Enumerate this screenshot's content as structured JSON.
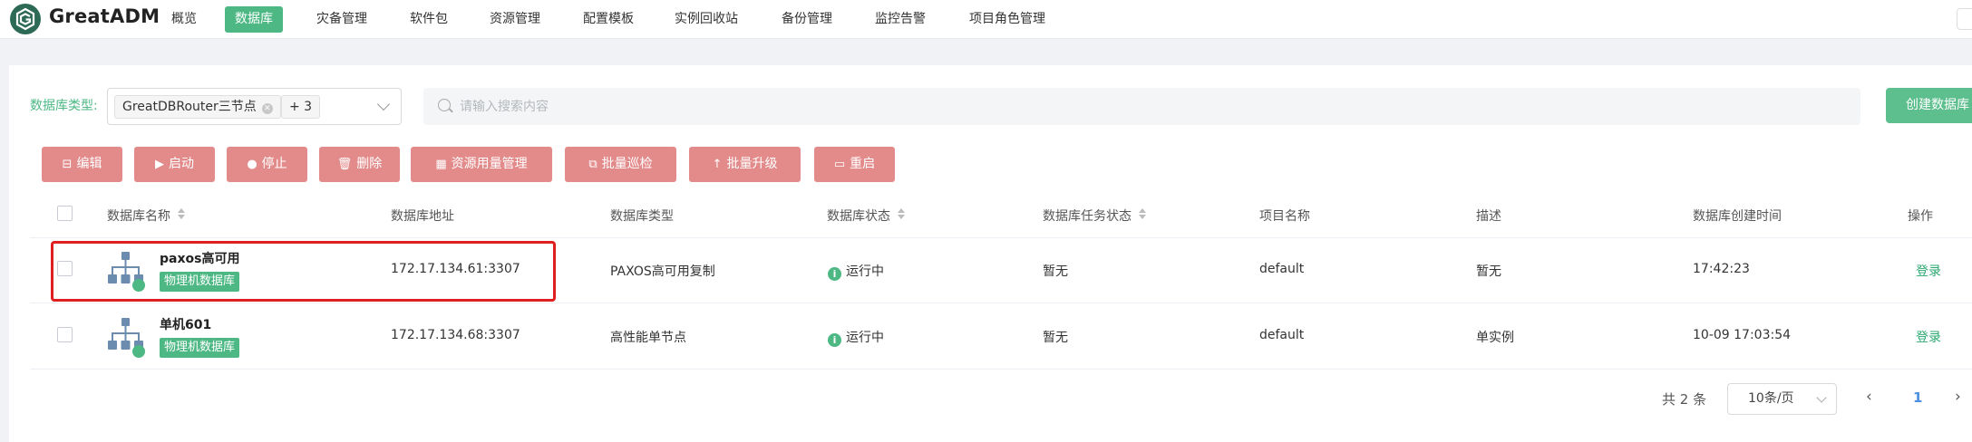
{
  "brand": "GreatADM",
  "nav": [
    {
      "label": "概览"
    },
    {
      "label": "数据库",
      "active": true
    },
    {
      "label": "灾备管理"
    },
    {
      "label": "软件包"
    },
    {
      "label": "资源管理"
    },
    {
      "label": "配置模板"
    },
    {
      "label": "实例回收站"
    },
    {
      "label": "备份管理"
    },
    {
      "label": "监控告警"
    },
    {
      "label": "项目角色管理"
    }
  ],
  "filter": {
    "label": "数据库类型:",
    "selected_tag": "GreatDBRouter三节点",
    "more_tag": "+ 3",
    "search_placeholder": "请输入搜索内容",
    "create_label": "创建数据库"
  },
  "actions": [
    {
      "label": "编辑",
      "icon": "edit-icon",
      "glyph": "⊟"
    },
    {
      "label": "启动",
      "icon": "play-icon",
      "glyph": "▶"
    },
    {
      "label": "停止",
      "icon": "stop-icon",
      "glyph": "●"
    },
    {
      "label": "删除",
      "icon": "trash-icon",
      "glyph": "🗑"
    },
    {
      "label": "资源用量管理",
      "icon": "grid-icon",
      "glyph": "▦"
    },
    {
      "label": "批量巡检",
      "icon": "inspect-icon",
      "glyph": "⧉"
    },
    {
      "label": "批量升级",
      "icon": "upgrade-icon",
      "glyph": "↑"
    },
    {
      "label": "重启",
      "icon": "restart-icon",
      "glyph": "▭"
    }
  ],
  "table": {
    "headers": {
      "name": "数据库名称",
      "address": "数据库地址",
      "type": "数据库类型",
      "status": "数据库状态",
      "task_status": "数据库任务状态",
      "project": "项目名称",
      "desc": "描述",
      "created": "数据库创建时间",
      "ops": "操作"
    },
    "rows": [
      {
        "name": "paxos高可用",
        "badge": "物理机数据库",
        "address": "172.17.134.61:3307",
        "type": "PAXOS高可用复制",
        "status": "运行中",
        "task_status": "暂无",
        "project": "default",
        "desc": "暂无",
        "created": "17:42:23",
        "op": "登录"
      },
      {
        "name": "单机601",
        "badge": "物理机数据库",
        "address": "172.17.134.68:3307",
        "type": "高性能单节点",
        "status": "运行中",
        "task_status": "暂无",
        "project": "default",
        "desc": "单实例",
        "created": "10-09 17:03:54",
        "op": "登录"
      }
    ]
  },
  "pagination": {
    "total": "共 2 条",
    "page_size": "10条/页",
    "current_page": "1",
    "prev_glyph": "‹",
    "next_glyph": "›"
  },
  "colors": {
    "accent": "#4db884",
    "action_button": "#e38b8b",
    "highlight_box": "#e02020",
    "link": "#2aa86f"
  }
}
